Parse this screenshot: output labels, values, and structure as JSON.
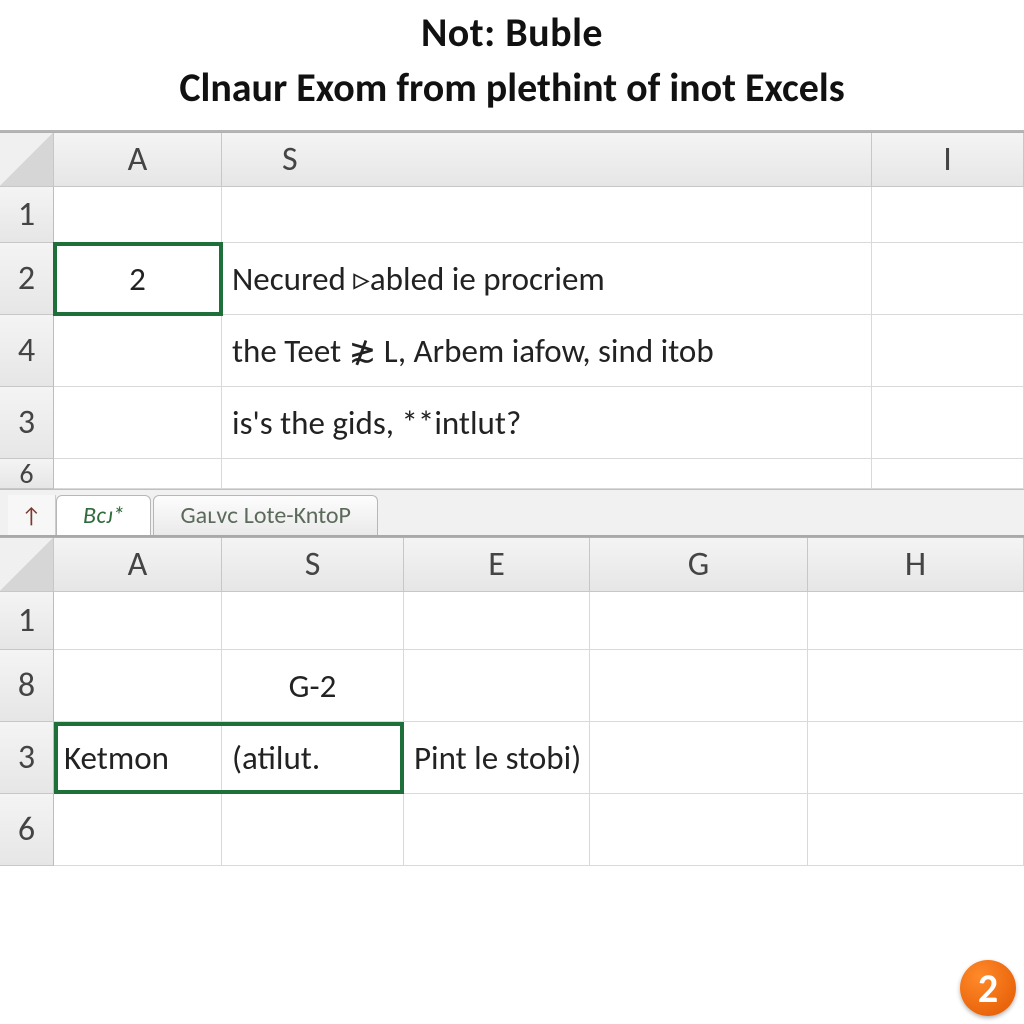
{
  "header": {
    "title": "Not: Buble",
    "subtitle": "Clnaur Exom from plethint of inot Excels"
  },
  "sheet_top": {
    "columns": [
      "A",
      "S",
      "I"
    ],
    "rows": [
      {
        "label": "1",
        "cells": [
          "",
          "",
          ""
        ]
      },
      {
        "label": "2",
        "cells": [
          "2",
          "Necured ▹abled ie procriem",
          ""
        ]
      },
      {
        "label": "4",
        "cells": [
          "",
          "the Teet ≵ L, Arbem iafow, sind itob",
          ""
        ]
      },
      {
        "label": "3",
        "cells": [
          "",
          "is's the gids, **intlut?",
          ""
        ]
      },
      {
        "label": "6",
        "cells": [
          "",
          "",
          ""
        ]
      }
    ],
    "selected_cell": "A2"
  },
  "tabs": {
    "arrow_icon": "↑",
    "items": [
      {
        "label": "Bᴄᴊ*",
        "active": true
      },
      {
        "label": "Gaʟvᴄ Lote-KntoP",
        "active": false
      }
    ]
  },
  "sheet_bottom": {
    "columns": [
      "A",
      "S",
      "E",
      "G",
      "H"
    ],
    "rows": [
      {
        "label": "1",
        "cells": [
          "",
          "",
          "",
          "",
          ""
        ]
      },
      {
        "label": "8",
        "cells": [
          "",
          "G-2",
          "",
          "",
          ""
        ]
      },
      {
        "label": "3",
        "cells": [
          "Ketmon",
          "(atilut.",
          "Pint le stobi)",
          "",
          ""
        ]
      },
      {
        "label": "6",
        "cells": [
          "",
          "",
          "",
          "",
          ""
        ]
      }
    ],
    "selected_range": "A3:S3"
  },
  "badge": "2"
}
